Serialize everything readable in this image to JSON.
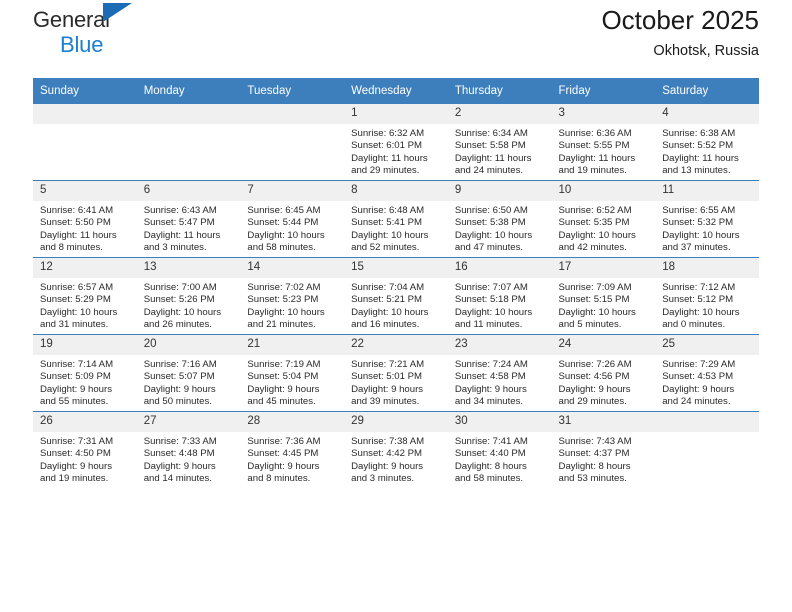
{
  "brand": {
    "line1": "General",
    "line2": "Blue",
    "icon": "triangle-logo"
  },
  "header": {
    "title": "October 2025",
    "subtitle": "Okhotsk, Russia"
  },
  "calendar": {
    "weekday_headers": [
      "Sunday",
      "Monday",
      "Tuesday",
      "Wednesday",
      "Thursday",
      "Friday",
      "Saturday"
    ],
    "accent_color": "#3d7ebd",
    "daynum_background": "#f0f0f0",
    "weeks": [
      [
        {
          "day": "",
          "lines": []
        },
        {
          "day": "",
          "lines": []
        },
        {
          "day": "",
          "lines": []
        },
        {
          "day": "1",
          "lines": [
            "Sunrise: 6:32 AM",
            "Sunset: 6:01 PM",
            "Daylight: 11 hours",
            "and 29 minutes."
          ]
        },
        {
          "day": "2",
          "lines": [
            "Sunrise: 6:34 AM",
            "Sunset: 5:58 PM",
            "Daylight: 11 hours",
            "and 24 minutes."
          ]
        },
        {
          "day": "3",
          "lines": [
            "Sunrise: 6:36 AM",
            "Sunset: 5:55 PM",
            "Daylight: 11 hours",
            "and 19 minutes."
          ]
        },
        {
          "day": "4",
          "lines": [
            "Sunrise: 6:38 AM",
            "Sunset: 5:52 PM",
            "Daylight: 11 hours",
            "and 13 minutes."
          ]
        }
      ],
      [
        {
          "day": "5",
          "lines": [
            "Sunrise: 6:41 AM",
            "Sunset: 5:50 PM",
            "Daylight: 11 hours",
            "and 8 minutes."
          ]
        },
        {
          "day": "6",
          "lines": [
            "Sunrise: 6:43 AM",
            "Sunset: 5:47 PM",
            "Daylight: 11 hours",
            "and 3 minutes."
          ]
        },
        {
          "day": "7",
          "lines": [
            "Sunrise: 6:45 AM",
            "Sunset: 5:44 PM",
            "Daylight: 10 hours",
            "and 58 minutes."
          ]
        },
        {
          "day": "8",
          "lines": [
            "Sunrise: 6:48 AM",
            "Sunset: 5:41 PM",
            "Daylight: 10 hours",
            "and 52 minutes."
          ]
        },
        {
          "day": "9",
          "lines": [
            "Sunrise: 6:50 AM",
            "Sunset: 5:38 PM",
            "Daylight: 10 hours",
            "and 47 minutes."
          ]
        },
        {
          "day": "10",
          "lines": [
            "Sunrise: 6:52 AM",
            "Sunset: 5:35 PM",
            "Daylight: 10 hours",
            "and 42 minutes."
          ]
        },
        {
          "day": "11",
          "lines": [
            "Sunrise: 6:55 AM",
            "Sunset: 5:32 PM",
            "Daylight: 10 hours",
            "and 37 minutes."
          ]
        }
      ],
      [
        {
          "day": "12",
          "lines": [
            "Sunrise: 6:57 AM",
            "Sunset: 5:29 PM",
            "Daylight: 10 hours",
            "and 31 minutes."
          ]
        },
        {
          "day": "13",
          "lines": [
            "Sunrise: 7:00 AM",
            "Sunset: 5:26 PM",
            "Daylight: 10 hours",
            "and 26 minutes."
          ]
        },
        {
          "day": "14",
          "lines": [
            "Sunrise: 7:02 AM",
            "Sunset: 5:23 PM",
            "Daylight: 10 hours",
            "and 21 minutes."
          ]
        },
        {
          "day": "15",
          "lines": [
            "Sunrise: 7:04 AM",
            "Sunset: 5:21 PM",
            "Daylight: 10 hours",
            "and 16 minutes."
          ]
        },
        {
          "day": "16",
          "lines": [
            "Sunrise: 7:07 AM",
            "Sunset: 5:18 PM",
            "Daylight: 10 hours",
            "and 11 minutes."
          ]
        },
        {
          "day": "17",
          "lines": [
            "Sunrise: 7:09 AM",
            "Sunset: 5:15 PM",
            "Daylight: 10 hours",
            "and 5 minutes."
          ]
        },
        {
          "day": "18",
          "lines": [
            "Sunrise: 7:12 AM",
            "Sunset: 5:12 PM",
            "Daylight: 10 hours",
            "and 0 minutes."
          ]
        }
      ],
      [
        {
          "day": "19",
          "lines": [
            "Sunrise: 7:14 AM",
            "Sunset: 5:09 PM",
            "Daylight: 9 hours",
            "and 55 minutes."
          ]
        },
        {
          "day": "20",
          "lines": [
            "Sunrise: 7:16 AM",
            "Sunset: 5:07 PM",
            "Daylight: 9 hours",
            "and 50 minutes."
          ]
        },
        {
          "day": "21",
          "lines": [
            "Sunrise: 7:19 AM",
            "Sunset: 5:04 PM",
            "Daylight: 9 hours",
            "and 45 minutes."
          ]
        },
        {
          "day": "22",
          "lines": [
            "Sunrise: 7:21 AM",
            "Sunset: 5:01 PM",
            "Daylight: 9 hours",
            "and 39 minutes."
          ]
        },
        {
          "day": "23",
          "lines": [
            "Sunrise: 7:24 AM",
            "Sunset: 4:58 PM",
            "Daylight: 9 hours",
            "and 34 minutes."
          ]
        },
        {
          "day": "24",
          "lines": [
            "Sunrise: 7:26 AM",
            "Sunset: 4:56 PM",
            "Daylight: 9 hours",
            "and 29 minutes."
          ]
        },
        {
          "day": "25",
          "lines": [
            "Sunrise: 7:29 AM",
            "Sunset: 4:53 PM",
            "Daylight: 9 hours",
            "and 24 minutes."
          ]
        }
      ],
      [
        {
          "day": "26",
          "lines": [
            "Sunrise: 7:31 AM",
            "Sunset: 4:50 PM",
            "Daylight: 9 hours",
            "and 19 minutes."
          ]
        },
        {
          "day": "27",
          "lines": [
            "Sunrise: 7:33 AM",
            "Sunset: 4:48 PM",
            "Daylight: 9 hours",
            "and 14 minutes."
          ]
        },
        {
          "day": "28",
          "lines": [
            "Sunrise: 7:36 AM",
            "Sunset: 4:45 PM",
            "Daylight: 9 hours",
            "and 8 minutes."
          ]
        },
        {
          "day": "29",
          "lines": [
            "Sunrise: 7:38 AM",
            "Sunset: 4:42 PM",
            "Daylight: 9 hours",
            "and 3 minutes."
          ]
        },
        {
          "day": "30",
          "lines": [
            "Sunrise: 7:41 AM",
            "Sunset: 4:40 PM",
            "Daylight: 8 hours",
            "and 58 minutes."
          ]
        },
        {
          "day": "31",
          "lines": [
            "Sunrise: 7:43 AM",
            "Sunset: 4:37 PM",
            "Daylight: 8 hours",
            "and 53 minutes."
          ]
        },
        {
          "day": "",
          "lines": []
        }
      ]
    ]
  }
}
